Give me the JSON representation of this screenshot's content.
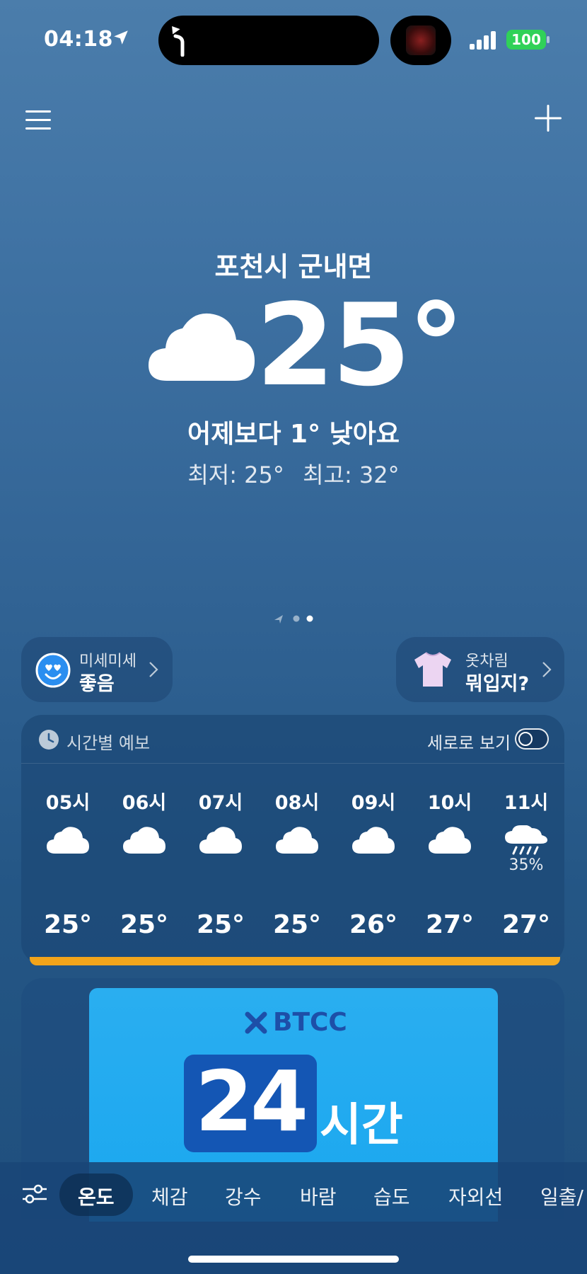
{
  "status_bar": {
    "time": "04:18",
    "battery": "100"
  },
  "location": "포천시 군내면",
  "current": {
    "temp": "25°",
    "condition_icon": "cloud-icon",
    "compare": "어제보다 1° 낮아요",
    "min": "최저: 25°",
    "max": "최고: 32°"
  },
  "pills": {
    "dust": {
      "label": "미세미세",
      "value": "좋음",
      "icon": "smiley-heart-eyes-icon"
    },
    "outfit": {
      "label": "옷차림",
      "value": "뭐입지?",
      "icon": "shirt-icon"
    }
  },
  "hourly": {
    "title": "시간별 예보",
    "vertical_view_label": "세로로 보기",
    "vertical_view_enabled": false,
    "hours": [
      {
        "time": "05시",
        "icon": "cloud-icon",
        "precip": "",
        "temp": "25°"
      },
      {
        "time": "06시",
        "icon": "cloud-icon",
        "precip": "",
        "temp": "25°"
      },
      {
        "time": "07시",
        "icon": "cloud-icon",
        "precip": "",
        "temp": "25°"
      },
      {
        "time": "08시",
        "icon": "cloud-icon",
        "precip": "",
        "temp": "25°"
      },
      {
        "time": "09시",
        "icon": "cloud-icon",
        "precip": "",
        "temp": "26°"
      },
      {
        "time": "10시",
        "icon": "cloud-icon",
        "precip": "",
        "temp": "27°"
      },
      {
        "time": "11시",
        "icon": "rain-cloud-icon",
        "precip": "35%",
        "temp": "27°"
      }
    ]
  },
  "ad": {
    "brand": "BTCC",
    "number": "24",
    "suffix": "시간"
  },
  "tabs": {
    "items": [
      "온도",
      "체감",
      "강수",
      "바람",
      "습도",
      "자외선",
      "일출/"
    ],
    "active": "온도"
  },
  "colors": {
    "accent_bar": "#f2a41a",
    "battery": "#30d158"
  }
}
